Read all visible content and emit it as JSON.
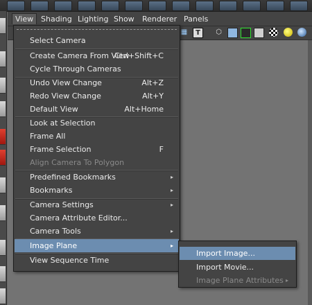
{
  "panel_menu": [
    "View",
    "Shading",
    "Lighting",
    "Show",
    "Renderer",
    "Panels"
  ],
  "view_menu": [
    {
      "label": "Select Camera",
      "shortcut": ""
    },
    {
      "label": "Create Camera From View",
      "shortcut": "Ctrl+Shift+C"
    },
    {
      "label": "Cycle Through Cameras",
      "shortcut": ""
    },
    {
      "label": "Undo View Change",
      "shortcut": "Alt+Z"
    },
    {
      "label": "Redo View Change",
      "shortcut": "Alt+Y"
    },
    {
      "label": "Default View",
      "shortcut": "Alt+Home"
    },
    {
      "label": "Look at Selection",
      "shortcut": ""
    },
    {
      "label": "Frame All",
      "shortcut": ""
    },
    {
      "label": "Frame Selection",
      "shortcut": "F"
    },
    {
      "label": "Align Camera To Polygon",
      "shortcut": ""
    },
    {
      "label": "Predefined Bookmarks",
      "shortcut": ""
    },
    {
      "label": "Bookmarks",
      "shortcut": ""
    },
    {
      "label": "Camera Settings",
      "shortcut": ""
    },
    {
      "label": "Camera Attribute Editor...",
      "shortcut": ""
    },
    {
      "label": "Camera Tools",
      "shortcut": ""
    },
    {
      "label": "Image Plane",
      "shortcut": ""
    },
    {
      "label": "View Sequence Time",
      "shortcut": ""
    }
  ],
  "image_plane_submenu": [
    {
      "label": "Import Image..."
    },
    {
      "label": "Import Movie..."
    },
    {
      "label": "Image Plane Attributes"
    }
  ],
  "submenu_arrow": "▸",
  "toolbar": {
    "text_icon_glyph": "T"
  },
  "colors": {
    "menu_bg": "#444444",
    "highlight": "#6c8db0",
    "disabled_text": "#8a8a8a",
    "viewport_bg": "#737373"
  }
}
